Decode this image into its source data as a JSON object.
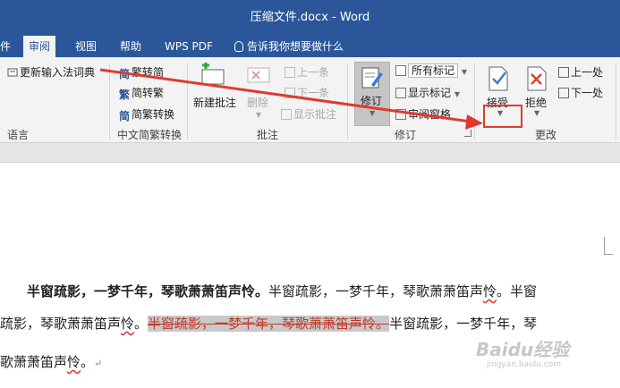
{
  "window": {
    "title": "压缩文件.docx  -  Word"
  },
  "tabs": [
    "审阅",
    "视图",
    "帮助",
    "WPS PDF"
  ],
  "active_tab": "审阅",
  "tell_me": "告诉我你想要做什么",
  "ribbon": {
    "language": {
      "update_ime": "更新输入法词典",
      "label": "语言"
    },
    "chinese": {
      "trad": "繁转简",
      "simp": "简转繁",
      "convert": "简繁转换",
      "label": "中文简繁转换"
    },
    "comments": {
      "new": "新建批注",
      "delete": "删除",
      "prev": "上一条",
      "next": "下一条",
      "show": "显示批注",
      "label": "批注"
    },
    "tracking": {
      "track": "修订",
      "markup": "所有标记",
      "show_markup": "显示标记",
      "pane": "审阅窗格",
      "label": "修订"
    },
    "changes": {
      "accept": "接受",
      "reject": "拒绝",
      "prev": "上一处",
      "next": "下一处",
      "label": "更改"
    }
  },
  "document": {
    "line1_bold": "半窗疏影，一梦千年，琴歌萧萧笛声怜。",
    "line1_rest_a": "半窗疏影，一梦千年，琴歌萧萧笛声",
    "line1_rest_w": "怜",
    "line1_rest_b": "。半窗",
    "line2_a": "疏影，琴歌萧萧笛声",
    "line2_w1": "怜",
    "line2_b": "。",
    "line2_deleted": "半窗疏影，一梦千年，琴歌萧萧笛声怜。",
    "line2_c": "半窗疏影，一梦千年，琴",
    "line3_a": "歌萧萧笛声",
    "line3_w": "怜",
    "line3_b": "。"
  },
  "watermark": {
    "main": "Baidu经验",
    "sub": "jingyan.baidu.com"
  },
  "colors": {
    "accent": "#2b579a",
    "highlight": "#e03a2f"
  }
}
